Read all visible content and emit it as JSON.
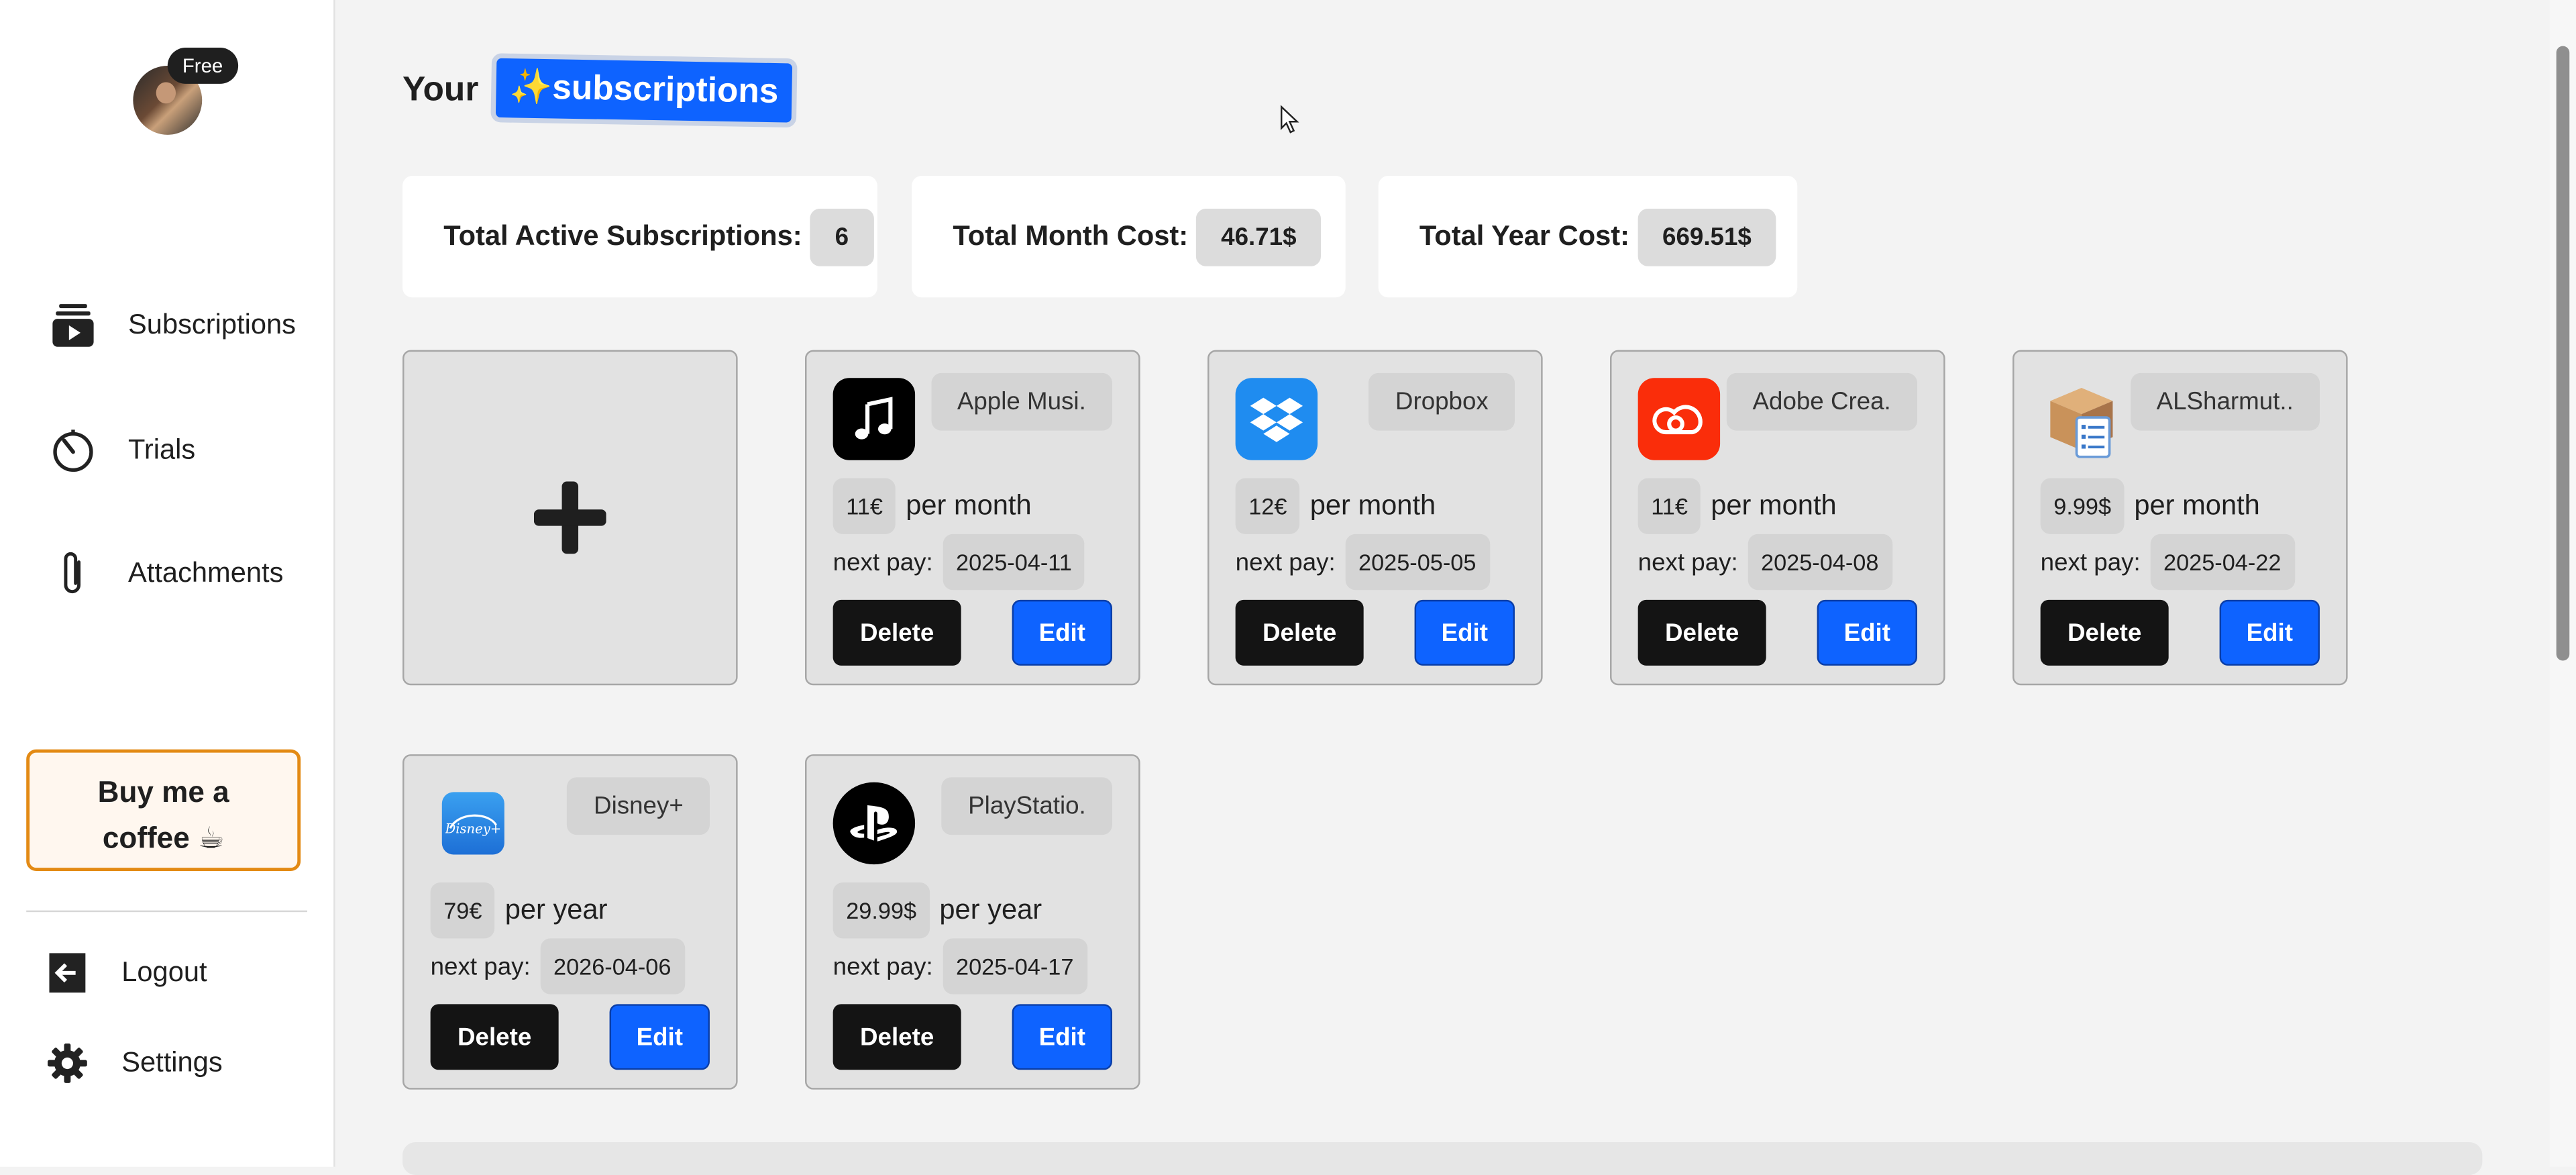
{
  "sidebar": {
    "badge": "Free",
    "nav": [
      {
        "label": "Subscriptions",
        "icon": "subscriptions-icon"
      },
      {
        "label": "Trials",
        "icon": "timer-icon"
      },
      {
        "label": "Attachments",
        "icon": "paperclip-icon"
      }
    ],
    "coffee_line1": "Buy me a",
    "coffee_line2": "coffee ☕",
    "logout": "Logout",
    "settings": "Settings"
  },
  "header": {
    "prefix": "Your",
    "highlight": "✨subscriptions"
  },
  "stats": [
    {
      "label": "Total Active Subscriptions:",
      "value": "6"
    },
    {
      "label": "Total Month Cost:",
      "value": "46.71$"
    },
    {
      "label": "Total Year Cost:",
      "value": "669.51$"
    }
  ],
  "cards": [
    {
      "name": "Apple Musi.",
      "price": "11€",
      "period": "per month",
      "next_label": "next pay:",
      "next": "2025-04-11",
      "logo": "apple-music-icon",
      "color": "#000000"
    },
    {
      "name": "Dropbox",
      "price": "12€",
      "period": "per month",
      "next_label": "next pay:",
      "next": "2025-05-05",
      "logo": "dropbox-icon",
      "color": "#1f8cf0"
    },
    {
      "name": "Adobe Crea.",
      "price": "11€",
      "period": "per month",
      "next_label": "next pay:",
      "next": "2025-04-08",
      "logo": "adobe-creative-cloud-icon",
      "color": "#fa2d0a"
    },
    {
      "name": "ALSharmut..",
      "price": "9.99$",
      "period": "per month",
      "next_label": "next pay:",
      "next": "2025-04-22",
      "logo": "box-checklist-icon",
      "color": "#c9925a"
    },
    {
      "name": "Disney+",
      "price": "79€",
      "period": "per year",
      "next_label": "next pay:",
      "next": "2026-04-06",
      "logo": "disney-plus-icon",
      "color": "#2b8fea"
    },
    {
      "name": "PlayStatio.",
      "price": "29.99$",
      "period": "per year",
      "next_label": "next pay:",
      "next": "2025-04-17",
      "logo": "playstation-icon",
      "color": "#000000"
    }
  ],
  "buttons": {
    "delete": "Delete",
    "edit": "Edit"
  }
}
